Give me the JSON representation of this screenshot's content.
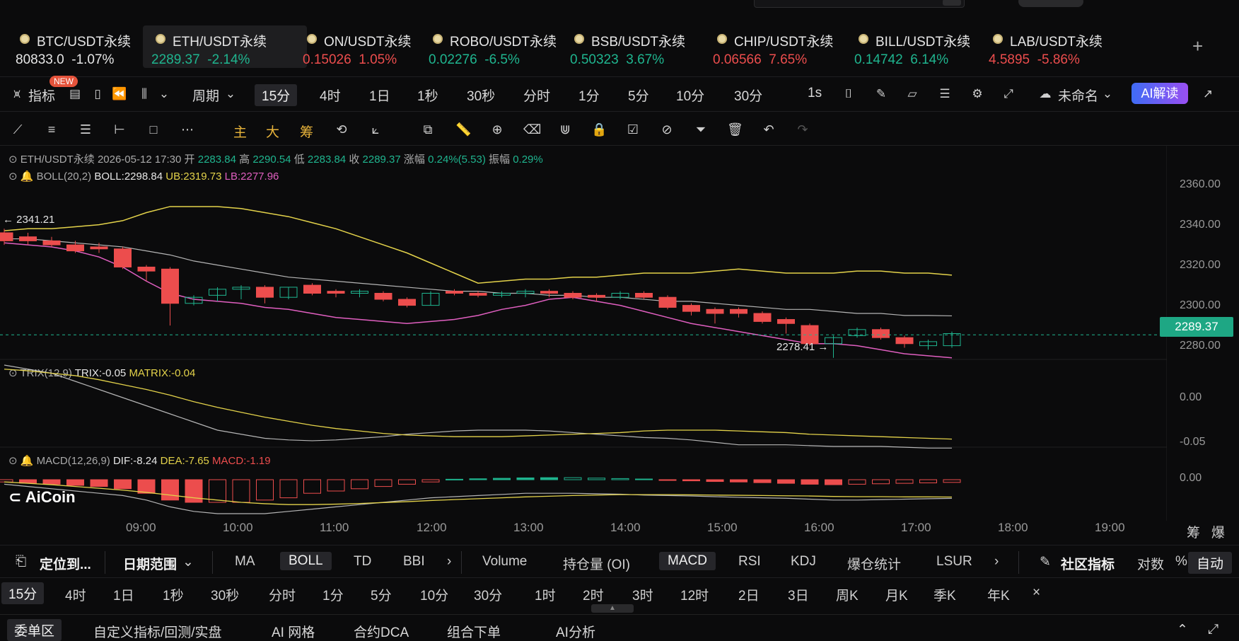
{
  "tickers": [
    {
      "name": "BTC/USDT永续",
      "price": "80833.0",
      "change": "-1.07%",
      "price_color": "white",
      "change_color": "white"
    },
    {
      "name": "ETH/USDT永续",
      "price": "2289.37",
      "change": "-2.14%",
      "price_color": "up",
      "change_color": "up"
    },
    {
      "name": "ON/USDT永续",
      "price": "0.15026",
      "change": "1.05%",
      "price_color": "down",
      "change_color": "down"
    },
    {
      "name": "ROBO/USDT永续",
      "price": "0.02276",
      "change": "-6.5%",
      "price_color": "up",
      "change_color": "up"
    },
    {
      "name": "BSB/USDT永续",
      "price": "0.50323",
      "change": "3.67%",
      "price_color": "up",
      "change_color": "up"
    },
    {
      "name": "CHIP/USDT永续",
      "price": "0.06566",
      "change": "7.65%",
      "price_color": "down",
      "change_color": "down"
    },
    {
      "name": "BILL/USDT永续",
      "price": "0.14742",
      "change": "6.14%",
      "price_color": "up",
      "change_color": "up"
    },
    {
      "name": "LAB/USDT永续",
      "price": "4.5895",
      "change": "-5.86%",
      "price_color": "down",
      "change_color": "down"
    }
  ],
  "toolbar": {
    "indicator_label": "指标",
    "new_badge": "NEW",
    "period_label": "周期",
    "periods": [
      "15分",
      "4时",
      "1日",
      "1秒",
      "30秒",
      "分时",
      "1分",
      "5分",
      "10分",
      "30分"
    ],
    "selected_period": "15分",
    "speed": "1s",
    "layout_name": "未命名",
    "ai_label": "AI解读"
  },
  "drawing": {
    "main_label": "主",
    "big_label": "大",
    "chip_label": "筹"
  },
  "chart_info": {
    "symbol": "ETH/USDT永续",
    "datetime": "2026-05-12 17:30",
    "open_label": "开",
    "open": "2283.84",
    "high_label": "高",
    "high": "2290.54",
    "low_label": "低",
    "low": "2283.84",
    "close_label": "收",
    "close": "2289.37",
    "chg_label": "涨幅",
    "chg": "0.24%(5.53)",
    "amp_label": "振幅",
    "amp": "0.29%",
    "boll_name": "BOLL(20,2)",
    "boll": "BOLL:2298.84",
    "ub": "UB:2319.73",
    "lb": "LB:2277.96",
    "trix_name": "TRIX(12,9)",
    "trix": "TRIX:-0.05",
    "matrix": "MATRIX:-0.04",
    "macd_name": "MACD(12,26,9)",
    "dif": "DIF:-8.24",
    "dea": "DEA:-7.65",
    "macd": "MACD:-1.19"
  },
  "price_axis": [
    "2360.00",
    "2340.00",
    "2320.00",
    "2300.00",
    "2280.00"
  ],
  "current_price_tag": "2289.37",
  "annotations": {
    "high": "2341.21",
    "low": "2278.41 →"
  },
  "trix_axis": [
    "0.00",
    "-0.05"
  ],
  "macd_axis": [
    "0.00"
  ],
  "logo": "AiCoin",
  "time_axis": [
    "09:00",
    "10:00",
    "11:00",
    "12:00",
    "13:00",
    "14:00",
    "15:00",
    "16:00",
    "17:00",
    "18:00",
    "19:00"
  ],
  "corner": {
    "chips": "筹",
    "liq": "爆"
  },
  "indicator_bar": {
    "locate": "定位到...",
    "date_range": "日期范围",
    "main_inds": [
      "MA",
      "BOLL",
      "TD",
      "BBI"
    ],
    "selected_main": "BOLL",
    "sub_inds": [
      "Volume",
      "持仓量 (OI)",
      "MACD",
      "RSI",
      "KDJ",
      "爆仓统计",
      "LSUR"
    ],
    "selected_sub": "MACD",
    "community": "社区指标",
    "log": "对数",
    "pct": "%",
    "auto": "自动"
  },
  "period_bar": {
    "items": [
      "15分",
      "4时",
      "1日",
      "1秒",
      "30秒",
      "分时",
      "1分",
      "5分",
      "10分",
      "30分",
      "1时",
      "2时",
      "3时",
      "12时",
      "2日",
      "3日",
      "周K",
      "月K",
      "季K",
      "年K"
    ],
    "selected": "15分",
    "close": "×"
  },
  "bottom_tabs": [
    "委单区",
    "自定义指标/回测/实盘",
    "AI 网格",
    "合约DCA",
    "组合下单",
    "AI分析"
  ],
  "colors": {
    "up": "#1fb58f",
    "down": "#ec4d4d",
    "boll_mid": "#e0e0e0",
    "boll_ub": "#e3d24a",
    "boll_lb": "#e05fc0",
    "accent": "#e8b43b"
  }
}
